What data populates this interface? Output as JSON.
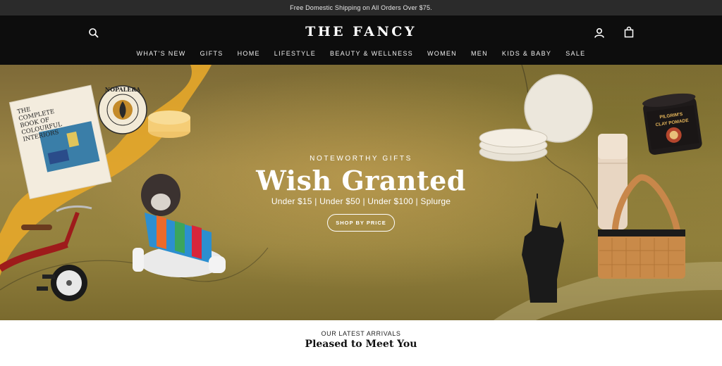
{
  "announcement": "Free Domestic Shipping on All Orders Over $75.",
  "header": {
    "logo": "THE FANCY",
    "icons": {
      "search": "search-icon",
      "account": "user-icon",
      "cart": "shopping-bag-icon"
    },
    "nav": [
      "WHAT'S NEW",
      "GIFTS",
      "HOME",
      "LIFESTYLE",
      "BEAUTY & WELLNESS",
      "WOMEN",
      "MEN",
      "KIDS & BABY",
      "SALE"
    ]
  },
  "hero": {
    "eyebrow": "NOTEWORTHY GIFTS",
    "title": "Wish Granted",
    "subtitle": "Under $15 | Under $50 | Under $100 | Splurge",
    "cta": "SHOP BY PRICE",
    "book": {
      "title_lines": [
        "THE",
        "COMPLETE",
        "BOOK OF",
        "COLOURFUL",
        "INTERIORS"
      ]
    },
    "seal_text": "NOPALERA",
    "pomade": {
      "brand": "PILGRIM'S",
      "product": "CLAY POMADE"
    }
  },
  "arrivals": {
    "eyebrow": "OUR LATEST ARRIVALS",
    "title": "Pleased to Meet You"
  },
  "colors": {
    "announcement_bg": "#2b2b2b",
    "header_bg": "#0d0d0d",
    "hero_gold": "#9c8645",
    "ribbon_yellow": "#e6a72a"
  }
}
